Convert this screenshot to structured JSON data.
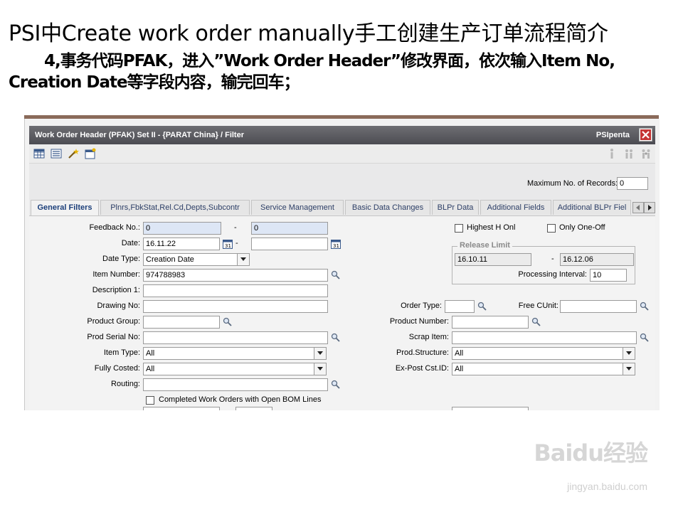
{
  "slide": {
    "title": "PSI中Create work order manually手工创建生产订单流程简介",
    "line1": "4,事务代码PFAK，进入”Work Order Header”修改界面，依次输入Item No,",
    "line2": "Creation Date等字段内容，输完回车；"
  },
  "window": {
    "title": "Work Order Header  (PFAK)  Set II - {PARAT China} / Filter",
    "brand": "PSIpenta",
    "close_icon": "close-icon"
  },
  "toolbar": {
    "icons": [
      "table-icon",
      "list-icon",
      "magic-wand-icon",
      "new-window-icon"
    ],
    "right_icons": [
      "info-icon",
      "users-icon",
      "users-group-icon"
    ]
  },
  "max_records": {
    "label": "Maximum No. of Records:",
    "value": "0"
  },
  "tabs": [
    {
      "label": "General Filters"
    },
    {
      "label": "Plnrs,FbkStat,Rel.Cd,Depts,Subcontr"
    },
    {
      "label": "Service Management"
    },
    {
      "label": "Basic Data Changes"
    },
    {
      "label": "BLPr Data"
    },
    {
      "label": "Additional Fields"
    },
    {
      "label": "Additional BLPr Fiel"
    }
  ],
  "form": {
    "feedback_no": {
      "label": "Feedback No.:",
      "from": "0",
      "sep": "-",
      "to": "0"
    },
    "date": {
      "label": "Date:",
      "from": "16.11.22",
      "sep": "-",
      "to": ""
    },
    "date_type": {
      "label": "Date Type:",
      "value": "Creation Date"
    },
    "item_number": {
      "label": "Item Number:",
      "value": "974788983"
    },
    "description": {
      "label": "Description 1:",
      "value": ""
    },
    "drawing_no": {
      "label": "Drawing No:",
      "value": ""
    },
    "product_group": {
      "label": "Product Group:",
      "value": ""
    },
    "prod_serial_no": {
      "label": "Prod Serial No:",
      "value": ""
    },
    "item_type": {
      "label": "Item Type:",
      "value": "All"
    },
    "fully_costed": {
      "label": "Fully Costed:",
      "value": "All"
    },
    "routing": {
      "label": "Routing:",
      "value": ""
    },
    "completed_wo": {
      "label": "Completed Work Orders with Open BOM Lines"
    },
    "highest_h_onl": {
      "label": "Highest H Onl"
    },
    "only_one_off": {
      "label": "Only One-Off"
    },
    "release_limit": {
      "legend": "Release Limit",
      "from": "16.10.11",
      "sep": "-",
      "to": "16.12.06",
      "interval_label": "Processing Interval:",
      "interval": "10"
    },
    "order_type": {
      "label": "Order Type:",
      "value": ""
    },
    "free_cunit": {
      "label": "Free CUnit:",
      "value": ""
    },
    "product_number": {
      "label": "Product Number:",
      "value": ""
    },
    "scrap_item": {
      "label": "Scrap Item:",
      "value": ""
    },
    "prod_structure": {
      "label": "Prod.Structure:",
      "value": "All"
    },
    "ex_post": {
      "label": "Ex-Post Cst.ID:",
      "value": "All"
    }
  },
  "watermark": {
    "main": "Baidu经验",
    "sub": "jingyan.baidu.com"
  }
}
